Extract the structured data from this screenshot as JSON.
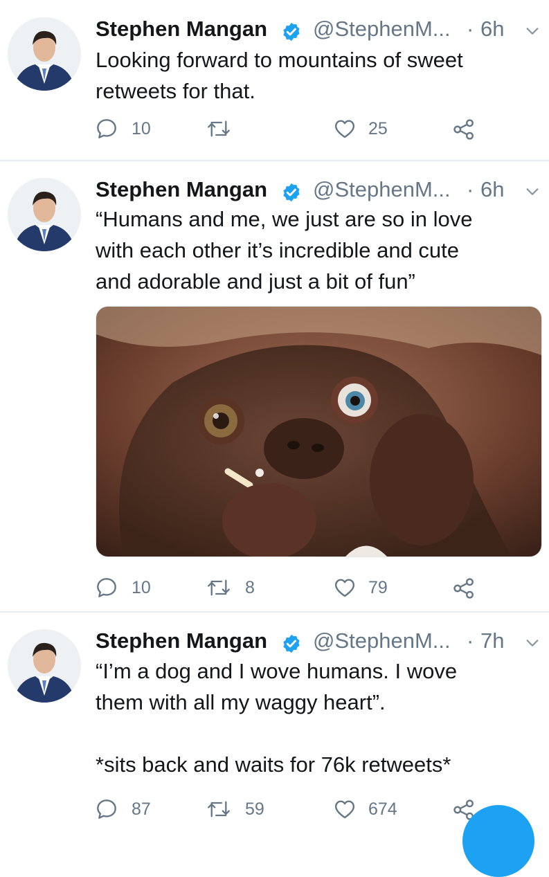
{
  "colors": {
    "brand": "#1da1f2",
    "secondary_text": "#657786",
    "divider": "#e6ecf0"
  },
  "tweets": [
    {
      "author_name": "Stephen Mangan",
      "handle": "@StephenM...",
      "separator": "·",
      "time": "6h",
      "text": "Looking forward to mountains of sweet\nretweets for that.",
      "replies": "10",
      "retweets": "",
      "likes": "25"
    },
    {
      "author_name": "Stephen Mangan",
      "handle": "@StephenM...",
      "separator": "·",
      "time": "6h",
      "text": "“Humans and me, we just are so in love\nwith each other it’s incredible and cute\nand adorable and just a bit of fun”",
      "replies": "10",
      "retweets": "8",
      "likes": "79"
    },
    {
      "author_name": "Stephen Mangan",
      "handle": "@StephenM...",
      "separator": "·",
      "time": "7h",
      "text": "“I’m a dog and I wove humans. I wove\nthem with all my waggy heart”.\n\n*sits back and waits for 76k retweets*",
      "replies": "87",
      "retweets": "59",
      "likes": "674"
    }
  ],
  "icons": {
    "verified": "verified-badge-icon",
    "menu": "chevron-down-icon",
    "reply": "reply-icon",
    "retweet": "retweet-icon",
    "like": "heart-icon",
    "share": "share-icon",
    "compose": "compose-fab"
  }
}
